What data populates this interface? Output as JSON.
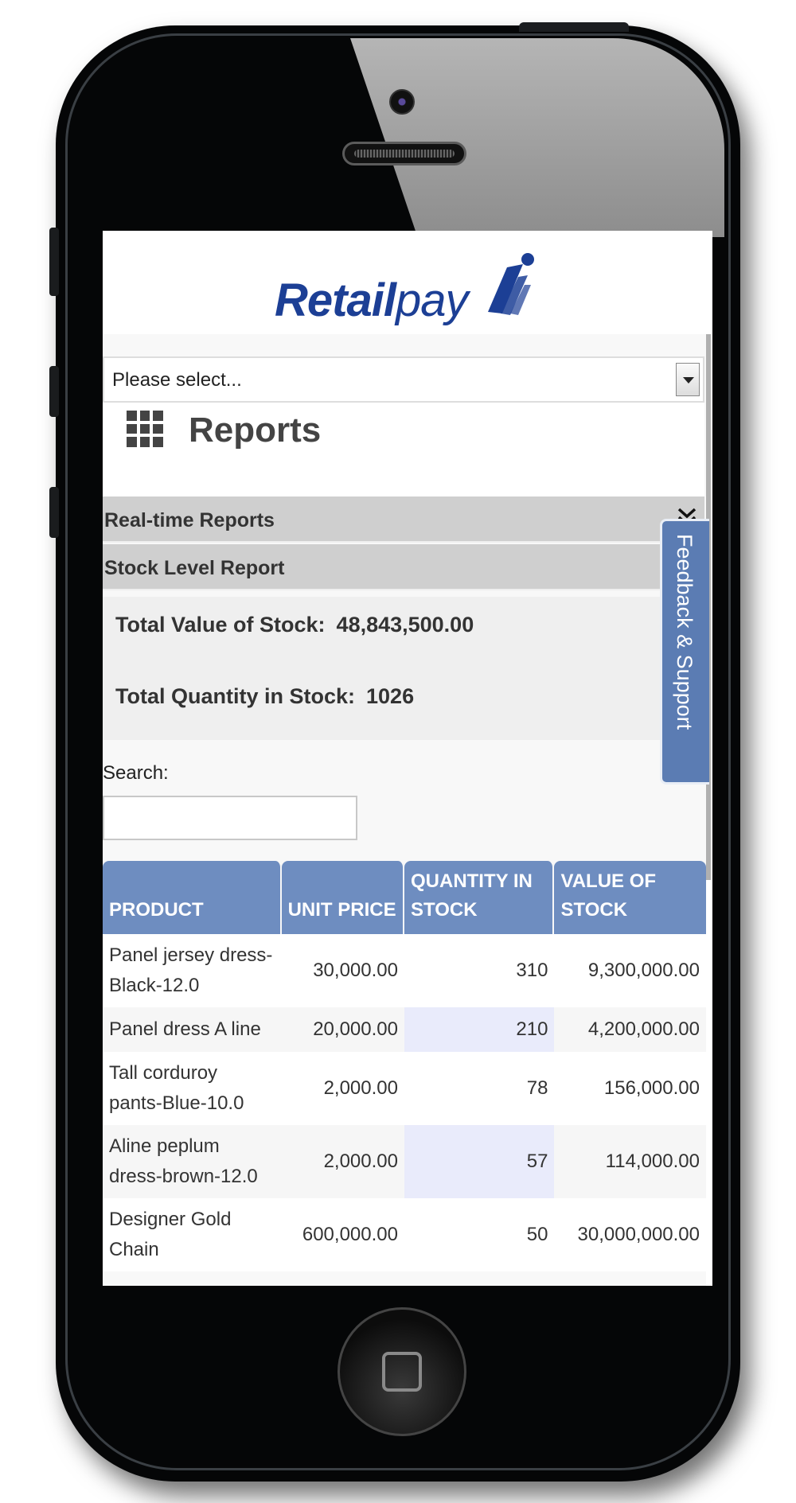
{
  "app": {
    "logo_text_bold": "Retail",
    "logo_text_light": "pay"
  },
  "select": {
    "value": "Please select..."
  },
  "reports": {
    "title": "Reports"
  },
  "accordion": {
    "realtime_label": "Real-time Reports",
    "stock_label": "Stock Level Report"
  },
  "summary": {
    "total_value_label": "Total Value of Stock:",
    "total_value": "48,843,500.00",
    "total_qty_label": "Total Quantity in Stock:",
    "total_qty": "1026"
  },
  "search": {
    "label": "Search:",
    "value": ""
  },
  "feedback": {
    "label": "Feedback & Support"
  },
  "table": {
    "headers": [
      "PRODUCT",
      "UNIT PRICE",
      "QUANTITY IN STOCK",
      "VALUE OF STOCK"
    ],
    "rows": [
      {
        "product": "Panel jersey dress-Black-12.0",
        "unit_price": "30,000.00",
        "quantity": "310",
        "value": "9,300,000.00"
      },
      {
        "product": "Panel dress A line",
        "unit_price": "20,000.00",
        "quantity": "210",
        "value": "4,200,000.00"
      },
      {
        "product": "Tall corduroy pants-Blue-10.0",
        "unit_price": "2,000.00",
        "quantity": "78",
        "value": "156,000.00"
      },
      {
        "product": "Aline peplum dress-brown-12.0",
        "unit_price": "2,000.00",
        "quantity": "57",
        "value": "114,000.00"
      },
      {
        "product": "Designer Gold Chain",
        "unit_price": "600,000.00",
        "quantity": "50",
        "value": "30,000,000.00"
      }
    ]
  },
  "colors": {
    "brand": "#1c3f95",
    "table_header": "#6e8dc0",
    "feedback_tab": "#5b7cb3",
    "highlight_cell": "#e9ebfb"
  }
}
